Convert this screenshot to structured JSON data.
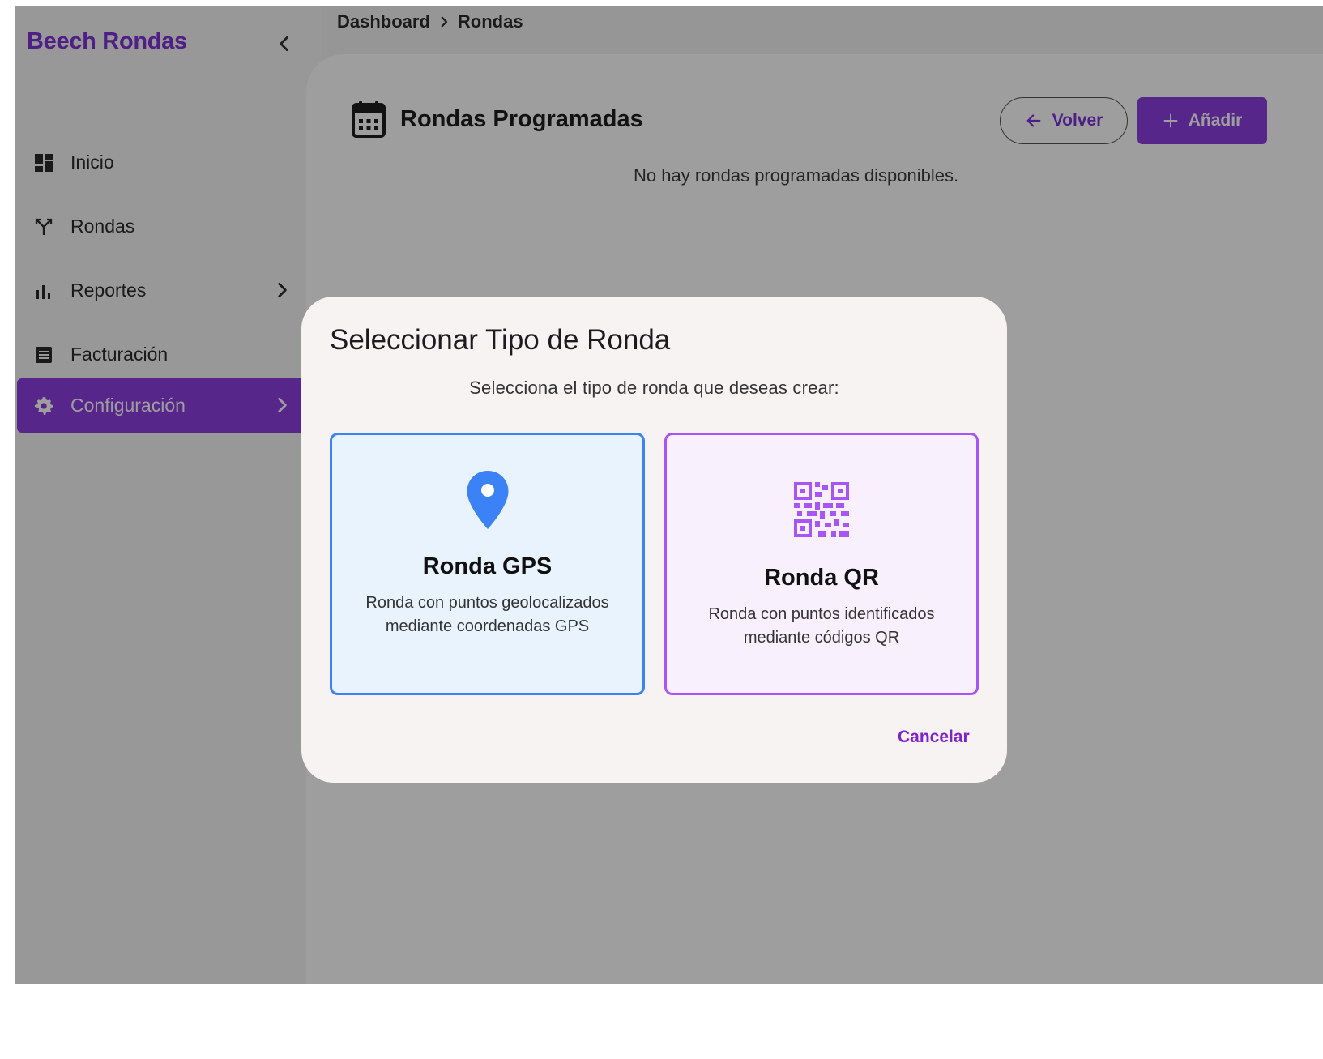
{
  "app": {
    "brand": "Beech Rondas"
  },
  "breadcrumb": {
    "items": [
      "Dashboard",
      "Rondas"
    ]
  },
  "sidebar": {
    "items": [
      {
        "label": "Inicio",
        "icon": "dashboard-icon"
      },
      {
        "label": "Rondas",
        "icon": "route-icon"
      },
      {
        "label": "Reportes",
        "icon": "bar-chart-icon",
        "has_submenu": true
      },
      {
        "label": "Facturación",
        "icon": "receipt-icon"
      },
      {
        "label": "Configuración",
        "icon": "gear-icon",
        "has_submenu": true,
        "active": true
      }
    ]
  },
  "page": {
    "title": "Rondas Programadas",
    "back_label": "Volver",
    "add_label": "Añadir",
    "empty_message": "No hay rondas programadas disponibles."
  },
  "dialog": {
    "title": "Seleccionar Tipo de Ronda",
    "subtitle": "Selecciona el tipo de ronda que deseas crear:",
    "options": [
      {
        "title": "Ronda GPS",
        "description": "Ronda con puntos geolocalizados mediante coordenadas GPS",
        "icon": "location-pin-icon"
      },
      {
        "title": "Ronda QR",
        "description": "Ronda con puntos identificados mediante códigos QR",
        "icon": "qr-code-icon"
      }
    ],
    "cancel_label": "Cancelar"
  },
  "colors": {
    "accent": "#8b3ee0",
    "gps": "#3b82f6",
    "qr": "#a855f7"
  }
}
